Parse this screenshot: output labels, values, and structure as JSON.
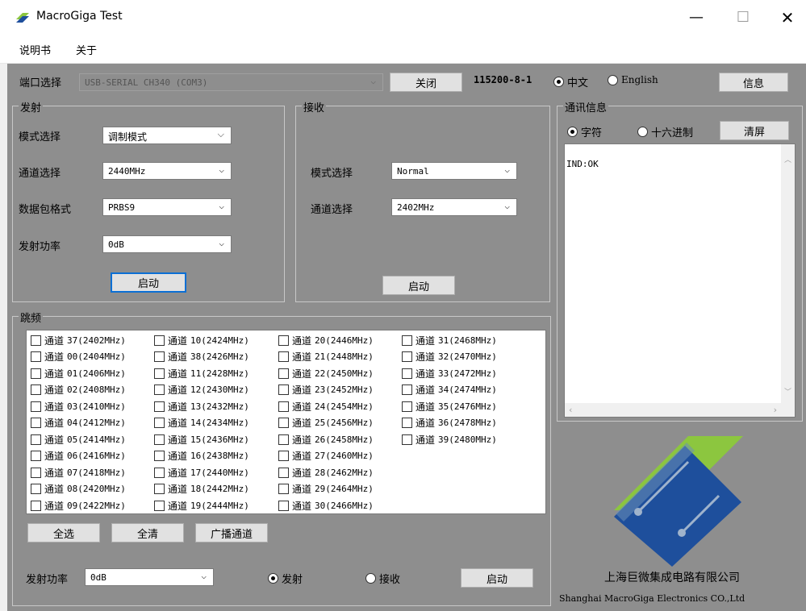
{
  "window": {
    "title": "MacroGiga Test",
    "min": "—",
    "max": "☐",
    "close": "✕"
  },
  "menu": {
    "items": [
      "说明书",
      "关于"
    ]
  },
  "port": {
    "label": "端口选择",
    "value": "USB-SERIAL CH340 (COM3)",
    "close_btn": "关闭",
    "baud": "115200-8-1",
    "lang_cn": "中文",
    "lang_en": "English",
    "info_btn": "信息"
  },
  "tx": {
    "title": "发射",
    "mode_label": "模式选择",
    "mode_value": "调制模式",
    "channel_label": "通道选择",
    "channel_value": "2440MHz",
    "packet_label": "数据包格式",
    "packet_value": "PRBS9",
    "power_label": "发射功率",
    "power_value": "0dB",
    "start": "启动"
  },
  "rx": {
    "title": "接收",
    "mode_label": "模式选择",
    "mode_value": "Normal",
    "channel_label": "通道选择",
    "channel_value": "2402MHz",
    "start": "启动"
  },
  "comm": {
    "title": "通讯信息",
    "char": "字符",
    "hex": "十六进制",
    "clear": "清屏",
    "log": "IND:OK"
  },
  "hop": {
    "title": "跳频",
    "prefix": "通道",
    "columns": [
      [
        "37(2402MHz)",
        "00(2404MHz)",
        "01(2406MHz)",
        "02(2408MHz)",
        "03(2410MHz)",
        "04(2412MHz)",
        "05(2414MHz)",
        "06(2416MHz)",
        "07(2418MHz)",
        "08(2420MHz)",
        "09(2422MHz)"
      ],
      [
        "10(2424MHz)",
        "38(2426MHz)",
        "11(2428MHz)",
        "12(2430MHz)",
        "13(2432MHz)",
        "14(2434MHz)",
        "15(2436MHz)",
        "16(2438MHz)",
        "17(2440MHz)",
        "18(2442MHz)",
        "19(2444MHz)"
      ],
      [
        "20(2446MHz)",
        "21(2448MHz)",
        "22(2450MHz)",
        "23(2452MHz)",
        "24(2454MHz)",
        "25(2456MHz)",
        "26(2458MHz)",
        "27(2460MHz)",
        "28(2462MHz)",
        "29(2464MHz)",
        "30(2466MHz)"
      ],
      [
        "31(2468MHz)",
        "32(2470MHz)",
        "33(2472MHz)",
        "34(2474MHz)",
        "35(2476MHz)",
        "36(2478MHz)",
        "39(2480MHz)"
      ]
    ],
    "select_all": "全选",
    "clear_all": "全清",
    "broadcast": "广播通道",
    "power_label": "发射功率",
    "power_value": "0dB",
    "mode_tx": "发射",
    "mode_rx": "接收",
    "start": "启动"
  },
  "company": {
    "cn": "上海巨微集成电路有限公司",
    "en": "Shanghai MacroGiga Electronics CO.,Ltd"
  },
  "colors": {
    "panel": "#8e8e8e",
    "logo_green": "#8cc63f",
    "logo_blue": "#1e4f9c"
  }
}
